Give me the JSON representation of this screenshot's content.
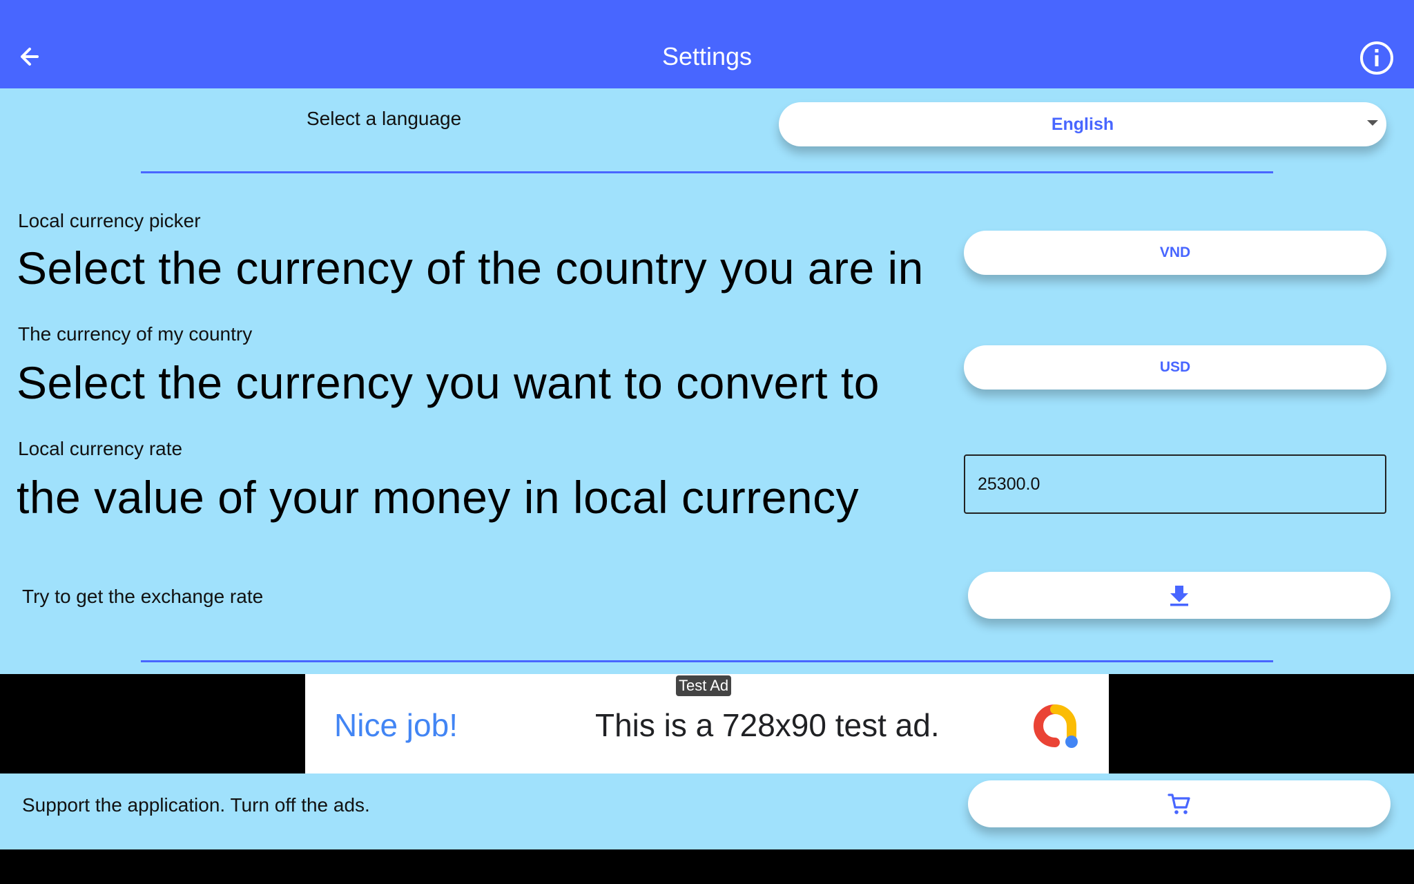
{
  "appbar": {
    "title": "Settings",
    "back_icon": "arrow-back-icon",
    "info_icon": "info-icon"
  },
  "language": {
    "label": "Select a language",
    "selected": "English"
  },
  "local_currency": {
    "small_label": "Local currency picker",
    "big_label": "Select the currency of the country you are in",
    "value": "VND"
  },
  "home_currency": {
    "small_label": "The currency of my country",
    "big_label": "Select the currency you want to convert to",
    "value": "USD"
  },
  "rate": {
    "small_label": "Local currency rate",
    "big_label": "the value of your money in local currency",
    "value": "25300.0"
  },
  "exchange": {
    "label": "Try to get the exchange rate",
    "icon": "download-icon"
  },
  "ad": {
    "badge": "Test Ad",
    "headline": "Nice job!",
    "body": "This is a 728x90 test ad.",
    "logo": "ad-manager-logo"
  },
  "support": {
    "label": "Support the application. Turn off the ads.",
    "icon": "cart-icon"
  },
  "colors": {
    "appbar": "#4866ff",
    "background": "#a0e1fc",
    "accent": "#4866ff"
  }
}
